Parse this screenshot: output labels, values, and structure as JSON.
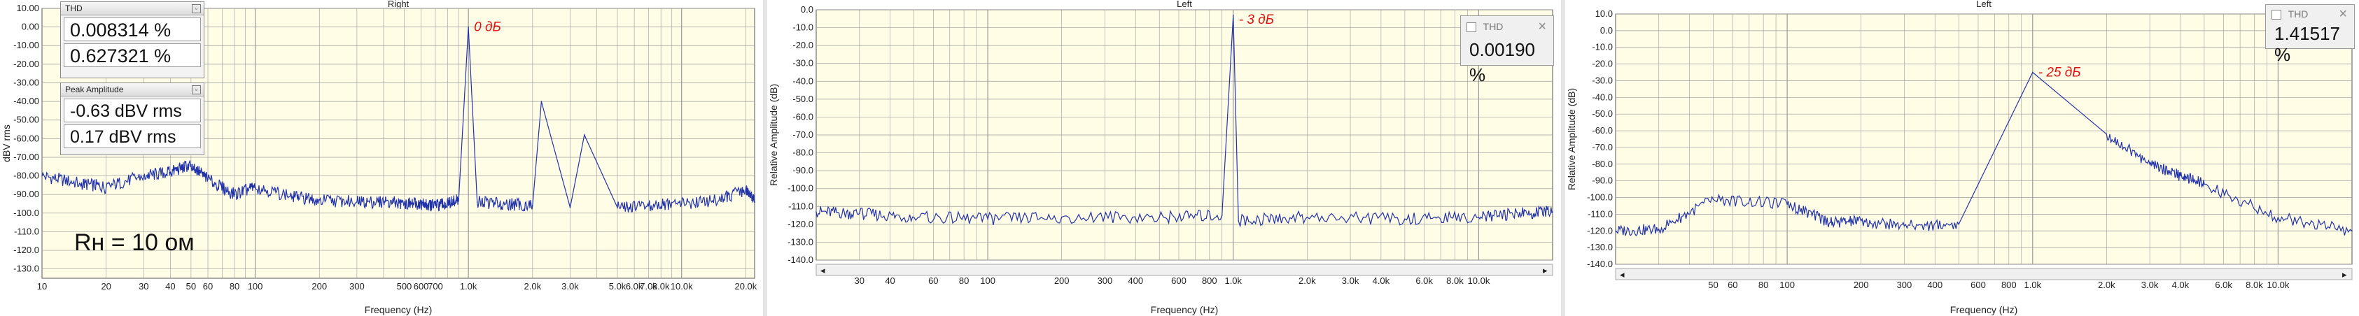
{
  "colors": {
    "plot_bg": "#fffde6",
    "grid": "#9a9a9a",
    "trace": "#2233aa",
    "peak_label": "#e01010",
    "divider": "#b8b8b8"
  },
  "panels": [
    {
      "title": "Right",
      "ylabel": "dBV rms",
      "xlabel": "Frequency (Hz)",
      "peak_label": "0 дБ",
      "y_ticks": [
        "10.00",
        "0.00",
        "-10.00",
        "-20.00",
        "-30.00",
        "-40.00",
        "-50.00",
        "-60.00",
        "-70.00",
        "-80.00",
        "-90.00",
        "-100.0",
        "-110.0",
        "-120.0",
        "-130.0"
      ],
      "x_ticks": [
        "10",
        "20",
        "30",
        "40",
        "50",
        "60",
        "80",
        "100",
        "200",
        "300",
        "500",
        "600",
        "700",
        "1.0k",
        "2.0k",
        "3.0k",
        "5.0k",
        "6.0k",
        "7.0k",
        "8.0k",
        "10.0k",
        "20.0k"
      ],
      "overlay_text": "Rн = 10 ом",
      "meters": [
        {
          "title": "THD",
          "values": [
            "0.008314 %",
            "0.627321 %"
          ]
        },
        {
          "title": "Peak Amplitude",
          "values": [
            "-0.63 dBV rms",
            "0.17 dBV rms"
          ]
        }
      ]
    },
    {
      "title": "Left",
      "ylabel": "Relative Amplitude (dB)",
      "xlabel": "Frequency (Hz)",
      "peak_label": "- 3 дБ",
      "y_ticks": [
        "0.0",
        "-10.0",
        "-20.0",
        "-30.0",
        "-40.0",
        "-50.0",
        "-60.0",
        "-70.0",
        "-80.0",
        "-90.0",
        "-100.0",
        "-110.0",
        "-120.0",
        "-130.0",
        "-140.0"
      ],
      "x_ticks": [
        "30",
        "40",
        "60",
        "80",
        "100",
        "200",
        "300",
        "400",
        "600",
        "800",
        "1.0k",
        "2.0k",
        "3.0k",
        "4.0k",
        "6.0k",
        "8.0k",
        "10.0k"
      ],
      "meter": {
        "title": "THD",
        "value": "0.00190 %"
      }
    },
    {
      "title": "Left",
      "ylabel": "Relative Amplitude (dB)",
      "xlabel": "Frequency (Hz)",
      "peak_label": "- 25 дБ",
      "y_ticks": [
        "10.0",
        "0.0",
        "-10.0",
        "-20.0",
        "-30.0",
        "-40.0",
        "-50.0",
        "-60.0",
        "-70.0",
        "-80.0",
        "-90.0",
        "-100.0",
        "-110.0",
        "-120.0",
        "-130.0",
        "-140.0"
      ],
      "x_ticks": [
        "50",
        "60",
        "80",
        "100",
        "200",
        "300",
        "400",
        "600",
        "800",
        "1.0k",
        "2.0k",
        "3.0k",
        "4.0k",
        "6.0k",
        "8.0k",
        "10.0k"
      ],
      "meter": {
        "title": "THD",
        "value": "1.41517 %"
      }
    }
  ],
  "chart_data": [
    {
      "type": "line",
      "title": "Right",
      "xlabel": "Frequency (Hz)",
      "ylabel": "dBV rms",
      "xlim": [
        10,
        22000
      ],
      "ylim": [
        -135,
        10
      ],
      "x_scale": "log",
      "grid": true,
      "annotations": [
        "0 дБ",
        "Rн = 10 ом"
      ],
      "series": [
        {
          "x": [
            10,
            15,
            20,
            30,
            40,
            50,
            60,
            80,
            100,
            150,
            200,
            300,
            400,
            500,
            600,
            700,
            800,
            900,
            1000,
            1100,
            1500,
            2000,
            2200,
            3000,
            3500,
            5000,
            7000,
            10000,
            15000,
            20000,
            22000
          ],
          "y": [
            -80,
            -84,
            -86,
            -80,
            -78,
            -74,
            -82,
            -90,
            -86,
            -91,
            -93,
            -94,
            -94,
            -95,
            -95,
            -96,
            -95,
            -93,
            0,
            -94,
            -95,
            -96,
            -40,
            -97,
            -58,
            -97,
            -96,
            -95,
            -93,
            -87,
            -94
          ]
        }
      ]
    },
    {
      "type": "line",
      "title": "Left",
      "xlabel": "Frequency (Hz)",
      "ylabel": "Relative Amplitude (dB)",
      "xlim": [
        20,
        20000
      ],
      "ylim": [
        -140,
        0
      ],
      "x_scale": "log",
      "grid": true,
      "annotations": [
        "- 3 дБ"
      ],
      "series": [
        {
          "x": [
            20,
            30,
            50,
            100,
            200,
            500,
            900,
            1000,
            1050,
            2000,
            5000,
            10000,
            15000,
            20000
          ],
          "y": [
            -113,
            -114,
            -116,
            -117,
            -116,
            -116,
            -115,
            -3,
            -118,
            -116,
            -117,
            -116,
            -114,
            -113
          ]
        }
      ]
    },
    {
      "type": "line",
      "title": "Left",
      "xlabel": "Frequency (Hz)",
      "ylabel": "Relative Amplitude (dB)",
      "xlim": [
        20,
        20000
      ],
      "ylim": [
        -140,
        10
      ],
      "x_scale": "log",
      "grid": true,
      "annotations": [
        "- 25 дБ"
      ],
      "series": [
        {
          "x": [
            20,
            30,
            50,
            100,
            150,
            200,
            300,
            500,
            1000,
            2000,
            3000,
            4000,
            5000,
            10000,
            20000
          ],
          "y": [
            -120,
            -119,
            -101,
            -104,
            -115,
            -114,
            -117,
            -116,
            -25,
            -62,
            -80,
            -87,
            -92,
            -112,
            -120
          ]
        }
      ]
    }
  ]
}
